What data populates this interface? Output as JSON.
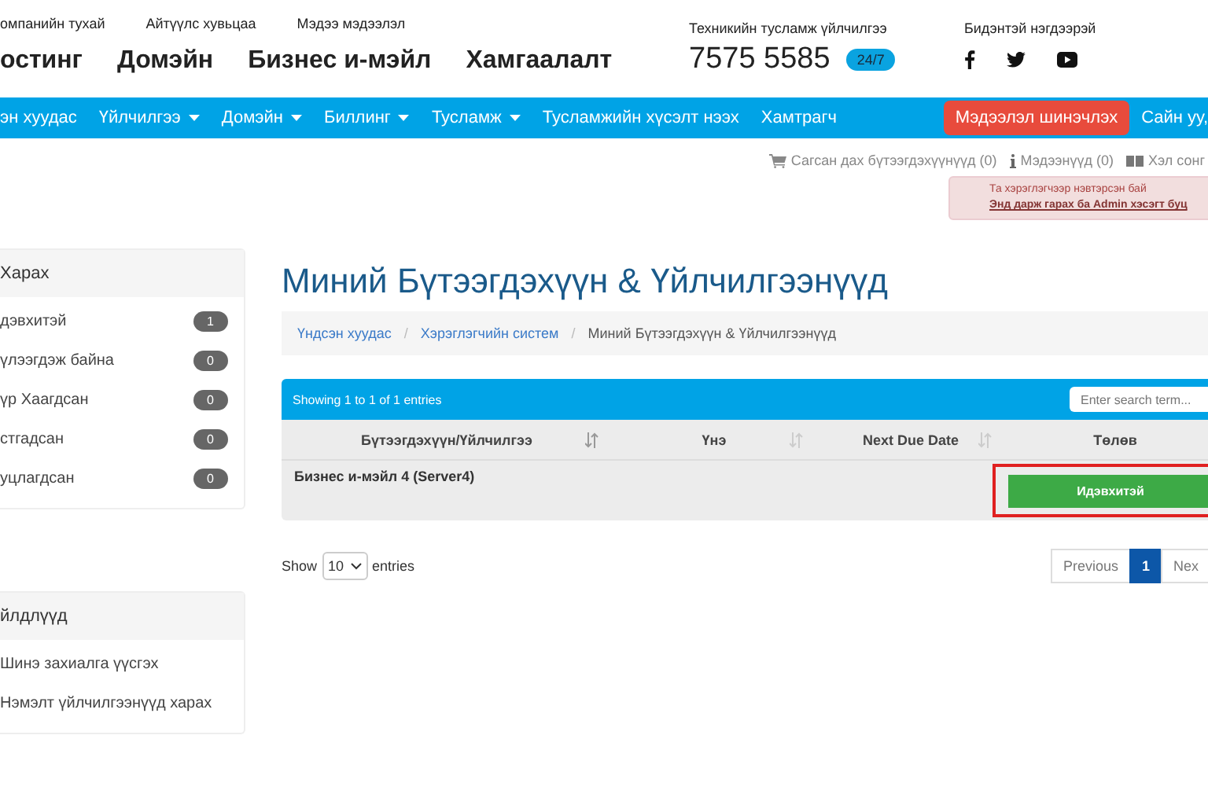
{
  "top_links": [
    "омпанийн тухай",
    "Айтүүлс хувьцаа",
    "Мэдээ мэдээлэл"
  ],
  "main_nav": [
    "остинг",
    "Домэйн",
    "Бизнес и-мэйл",
    "Хамгаалалт"
  ],
  "support": {
    "label": "Техникийн тусламж үйлчилгээ",
    "phone": "7575 5585",
    "badge": "24/7"
  },
  "social": {
    "label": "Бидэнтэй нэгдээрэй"
  },
  "navbar": {
    "items": [
      {
        "label": "эн хуудас",
        "dropdown": false
      },
      {
        "label": "Үйлчилгээ",
        "dropdown": true
      },
      {
        "label": "Домэйн",
        "dropdown": true
      },
      {
        "label": "Биллинг",
        "dropdown": true
      },
      {
        "label": "Тусламж",
        "dropdown": true
      },
      {
        "label": "Тусламжийн хүсэлт нээх",
        "dropdown": false
      },
      {
        "label": "Хамтрагч",
        "dropdown": false
      }
    ],
    "update_button": "Мэдээлэл шинэчлэх",
    "greeting": "Сайн уу,"
  },
  "utility": {
    "cart": "Сагсан дах бүтээгдэхүүнүүд (0)",
    "notices": "Мэдээнүүд (0)",
    "language": "Хэл сонг"
  },
  "alert": {
    "line": "Та хэрэглэгчээр нэвтэрсэн бай",
    "link": "Энд дарж гарах ба Admin хэсэгт буц"
  },
  "sidebar": {
    "view": {
      "title": "Харах",
      "items": [
        {
          "label": "дэвхитэй",
          "count": "1"
        },
        {
          "label": "үлээгдэж байна",
          "count": "0"
        },
        {
          "label": "үр Хаагдсан",
          "count": "0"
        },
        {
          "label": "стгадсан",
          "count": "0"
        },
        {
          "label": "уцлагдсан",
          "count": "0"
        }
      ]
    },
    "actions": {
      "title": "йлдлүүд",
      "items": [
        "Шинэ захиалга үүсгэх",
        "Нэмэлт үйлчилгээнүүд харах"
      ]
    }
  },
  "page_title": "Миний Бүтээгдэхүүн & Үйлчилгээнүүд",
  "breadcrumb": [
    {
      "label": "Үндсэн хуудас",
      "link": true
    },
    {
      "separator": "/"
    },
    {
      "label": "Хэрэглэгчийн систем",
      "link": true
    },
    {
      "separator": "/"
    },
    {
      "label": "Миний Бүтээгдэхүүн & Үйлчилгээнүүд",
      "link": false
    }
  ],
  "table": {
    "info": "Showing 1 to 1 of 1 entries",
    "search": {
      "placeholder": "Enter search term..."
    },
    "columns": [
      "Бүтээгдэхүүн/Үйлчилгээ",
      "Үнэ",
      "Next Due Date",
      "Төлөв"
    ],
    "rows": [
      {
        "product": "Бизнес и-мэйл 4 (Server4)",
        "status": "Идэвхитэй",
        "highlighted": true
      }
    ]
  },
  "length": {
    "show": "Show",
    "value": "10",
    "entries": "entries"
  },
  "pagination": [
    {
      "label": "Previous",
      "selected": false
    },
    {
      "label": "1",
      "selected": true
    },
    {
      "label": "Nex",
      "selected": false
    }
  ]
}
